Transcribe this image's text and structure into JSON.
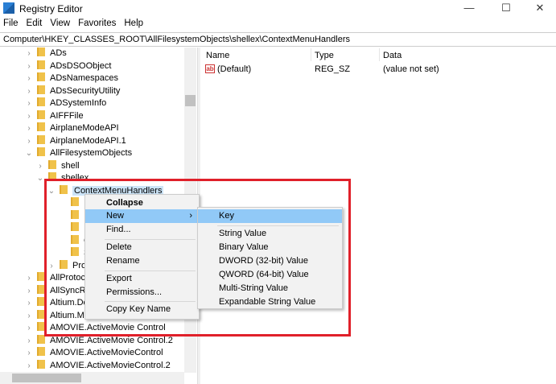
{
  "window": {
    "title": "Registry Editor",
    "minimize": "—",
    "maximize": "☐",
    "close": "✕"
  },
  "menubar": [
    "File",
    "Edit",
    "View",
    "Favorites",
    "Help"
  ],
  "address": "Computer\\HKEY_CLASSES_ROOT\\AllFilesystemObjects\\shellex\\ContextMenuHandlers",
  "tree": [
    {
      "label": "ADs",
      "indent": 0,
      "chev": "›"
    },
    {
      "label": "ADsDSOObject",
      "indent": 0,
      "chev": "›"
    },
    {
      "label": "ADsNamespaces",
      "indent": 0,
      "chev": "›"
    },
    {
      "label": "ADsSecurityUtility",
      "indent": 0,
      "chev": "›"
    },
    {
      "label": "ADSystemInfo",
      "indent": 0,
      "chev": "›"
    },
    {
      "label": "AIFFFile",
      "indent": 0,
      "chev": "›"
    },
    {
      "label": "AirplaneModeAPI",
      "indent": 0,
      "chev": "›"
    },
    {
      "label": "AirplaneModeAPI.1",
      "indent": 0,
      "chev": "›"
    },
    {
      "label": "AllFilesystemObjects",
      "indent": 0,
      "chev": "⌄"
    },
    {
      "label": "shell",
      "indent": 1,
      "chev": "›"
    },
    {
      "label": "shellex",
      "indent": 1,
      "chev": "⌄"
    },
    {
      "label": "ContextMenuHandlers",
      "indent": 2,
      "chev": "⌄",
      "selected": true
    },
    {
      "label": "",
      "indent": 3,
      "chev": ""
    },
    {
      "label": "",
      "indent": 3,
      "chev": ""
    },
    {
      "label": "",
      "indent": 3,
      "chev": ""
    },
    {
      "label": "C",
      "indent": 3,
      "chev": ""
    },
    {
      "label": "S",
      "indent": 3,
      "chev": ""
    },
    {
      "label": "Pro",
      "indent": 2,
      "chev": "›"
    },
    {
      "label": "AllProtoc",
      "indent": 0,
      "chev": "›"
    },
    {
      "label": "AllSyncRo",
      "indent": 0,
      "chev": "›"
    },
    {
      "label": "Altium.De",
      "indent": 0,
      "chev": "›"
    },
    {
      "label": "Altium.Mechatronic.Collaboration.r",
      "indent": 0,
      "chev": "›"
    },
    {
      "label": "AMOVIE.ActiveMovie Control",
      "indent": 0,
      "chev": "›"
    },
    {
      "label": "AMOVIE.ActiveMovie Control.2",
      "indent": 0,
      "chev": "›"
    },
    {
      "label": "AMOVIE.ActiveMovieControl",
      "indent": 0,
      "chev": "›"
    },
    {
      "label": "AMOVIE.ActiveMovieControl.2",
      "indent": 0,
      "chev": "›"
    }
  ],
  "values": {
    "headers": {
      "name": "Name",
      "type": "Type",
      "data": "Data"
    },
    "rows": [
      {
        "name": "(Default)",
        "type": "REG_SZ",
        "data": "(value not set)",
        "icon": "ab"
      }
    ]
  },
  "context_menu": {
    "items": [
      "Collapse",
      "New",
      "Find...",
      "Delete",
      "Rename",
      "Export",
      "Permissions...",
      "Copy Key Name"
    ],
    "submenu_arrow": "›"
  },
  "submenu": {
    "items": [
      "Key",
      "String Value",
      "Binary Value",
      "DWORD (32-bit) Value",
      "QWORD (64-bit) Value",
      "Multi-String Value",
      "Expandable String Value"
    ]
  },
  "colors": {
    "highlight": "#91c9f7",
    "annotation": "#e0202a"
  }
}
